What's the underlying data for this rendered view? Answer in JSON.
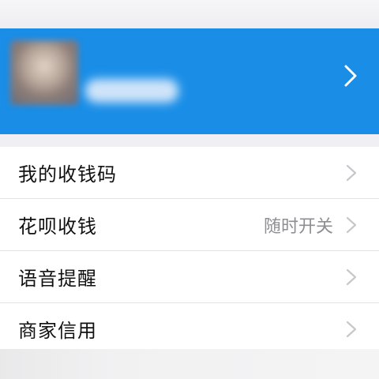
{
  "menu": {
    "items": [
      {
        "label": "我的收钱码",
        "value": "",
        "icon": "chevron-right-icon"
      },
      {
        "label": "花呗收钱",
        "value": "随时开关",
        "icon": "chevron-right-icon"
      },
      {
        "label": "语音提醒",
        "value": "",
        "icon": "chevron-right-icon"
      },
      {
        "label": "商家信用",
        "value": "",
        "icon": "chevron-right-icon"
      }
    ]
  },
  "colors": {
    "header_bg": "#1a8ee6",
    "page_bg": "#efeff4",
    "secondary_text": "#8e8e93",
    "chevron": "#c7c7cc"
  }
}
